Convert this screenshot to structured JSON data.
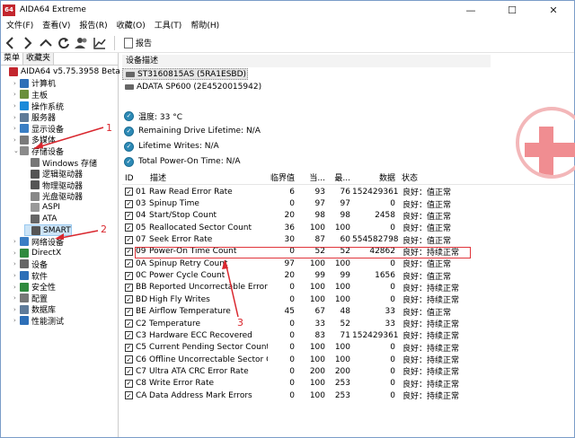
{
  "window": {
    "logo": "64",
    "title": "AIDA64 Extreme",
    "controls": [
      "—",
      "☐",
      "✕"
    ]
  },
  "menu": [
    "文件(F)",
    "查看(V)",
    "报告(R)",
    "收藏(O)",
    "工具(T)",
    "帮助(H)"
  ],
  "toolbar": {
    "icons": [
      "back-icon",
      "forward-icon",
      "up-icon",
      "refresh-icon",
      "users-icon",
      "chart-icon"
    ],
    "report_label": "报告"
  },
  "left_tabs": [
    "菜单",
    "收藏夹"
  ],
  "tree": [
    {
      "label": "AIDA64 v5.75.3958 Beta",
      "indent": 0,
      "tri": "",
      "color": "#c3262e"
    },
    {
      "label": "计算机",
      "indent": 1,
      "tri": "›",
      "color": "#2d6fb7"
    },
    {
      "label": "主板",
      "indent": 1,
      "tri": "›",
      "color": "#6a8f3c"
    },
    {
      "label": "操作系统",
      "indent": 1,
      "tri": "›",
      "color": "#1c8ad9"
    },
    {
      "label": "服务器",
      "indent": 1,
      "tri": "›",
      "color": "#5f7b99"
    },
    {
      "label": "显示设备",
      "indent": 1,
      "tri": "›",
      "color": "#3a7ec4"
    },
    {
      "label": "多媒体",
      "indent": 1,
      "tri": "›",
      "color": "#7a7a7a"
    },
    {
      "label": "存储设备",
      "indent": 1,
      "tri": "⌄",
      "color": "#8b8b8b"
    },
    {
      "label": "Windows 存储",
      "indent": 2,
      "tri": "",
      "color": "#777"
    },
    {
      "label": "逻辑驱动器",
      "indent": 2,
      "tri": "",
      "color": "#555"
    },
    {
      "label": "物理驱动器",
      "indent": 2,
      "tri": "",
      "color": "#555"
    },
    {
      "label": "光盘驱动器",
      "indent": 2,
      "tri": "",
      "color": "#888"
    },
    {
      "label": "ASPI",
      "indent": 2,
      "tri": "",
      "color": "#999"
    },
    {
      "label": "ATA",
      "indent": 2,
      "tri": "",
      "color": "#666"
    },
    {
      "label": "SMART",
      "indent": 2,
      "tri": "",
      "color": "#555",
      "selected": true
    },
    {
      "label": "网络设备",
      "indent": 1,
      "tri": "›",
      "color": "#3a7ec4"
    },
    {
      "label": "DirectX",
      "indent": 1,
      "tri": "›",
      "color": "#2f8a3e"
    },
    {
      "label": "设备",
      "indent": 1,
      "tri": "›",
      "color": "#666"
    },
    {
      "label": "软件",
      "indent": 1,
      "tri": "›",
      "color": "#2d6fb7"
    },
    {
      "label": "安全性",
      "indent": 1,
      "tri": "›",
      "color": "#2f8a3e"
    },
    {
      "label": "配置",
      "indent": 1,
      "tri": "›",
      "color": "#777"
    },
    {
      "label": "数据库",
      "indent": 1,
      "tri": "›",
      "color": "#5f7b99"
    },
    {
      "label": "性能测试",
      "indent": 1,
      "tri": "›",
      "color": "#2d6fb7"
    }
  ],
  "device_section": {
    "header": "设备描述",
    "devices": [
      {
        "name": "ST3160815AS (5RA1ESBD)",
        "selected": true
      },
      {
        "name": "ADATA SP600 (2E4520015942)",
        "selected": false
      }
    ]
  },
  "info": [
    "温度: 33 °C",
    "Remaining Drive Lifetime: N/A",
    "Lifetime Writes: N/A",
    "Total Power-On Time: N/A"
  ],
  "grid": {
    "headers": [
      "ID",
      "描述",
      "临界值",
      "当...",
      "最...",
      "数据",
      "状态"
    ],
    "rows": [
      [
        "01",
        "Raw Read Error Rate",
        "6",
        "93",
        "76",
        "152429361",
        "良好：值正常"
      ],
      [
        "03",
        "Spinup Time",
        "0",
        "97",
        "97",
        "0",
        "良好：值正常"
      ],
      [
        "04",
        "Start/Stop Count",
        "20",
        "98",
        "98",
        "2458",
        "良好：值正常"
      ],
      [
        "05",
        "Reallocated Sector Count",
        "36",
        "100",
        "100",
        "0",
        "良好：值正常"
      ],
      [
        "07",
        "Seek Error Rate",
        "30",
        "87",
        "60",
        "554582798",
        "良好：值正常"
      ],
      [
        "09",
        "Power-On Time Count",
        "0",
        "52",
        "52",
        "42862",
        "良好：持续正常"
      ],
      [
        "0A",
        "Spinup Retry Count",
        "97",
        "100",
        "100",
        "0",
        "良好：值正常"
      ],
      [
        "0C",
        "Power Cycle Count",
        "20",
        "99",
        "99",
        "1656",
        "良好：值正常"
      ],
      [
        "BB",
        "Reported Uncorrectable Errors",
        "0",
        "100",
        "100",
        "0",
        "良好：持续正常"
      ],
      [
        "BD",
        "High Fly Writes",
        "0",
        "100",
        "100",
        "0",
        "良好：持续正常"
      ],
      [
        "BE",
        "Airflow Temperature",
        "45",
        "67",
        "48",
        "33",
        "良好：值正常"
      ],
      [
        "C2",
        "Temperature",
        "0",
        "33",
        "52",
        "33",
        "良好：持续正常"
      ],
      [
        "C3",
        "Hardware ECC Recovered",
        "0",
        "83",
        "71",
        "152429361",
        "良好：持续正常"
      ],
      [
        "C5",
        "Current Pending Sector Count",
        "0",
        "100",
        "100",
        "0",
        "良好：持续正常"
      ],
      [
        "C6",
        "Offline Uncorrectable Sector C...",
        "0",
        "100",
        "100",
        "0",
        "良好：持续正常"
      ],
      [
        "C7",
        "Ultra ATA CRC Error Rate",
        "0",
        "200",
        "200",
        "0",
        "良好：持续正常"
      ],
      [
        "C8",
        "Write Error Rate",
        "0",
        "100",
        "253",
        "0",
        "良好：持续正常"
      ],
      [
        "CA",
        "Data Address Mark Errors",
        "0",
        "100",
        "253",
        "0",
        "良好：持续正常"
      ]
    ]
  },
  "annotations": [
    "1",
    "2",
    "3"
  ],
  "accent": "#d9272e"
}
